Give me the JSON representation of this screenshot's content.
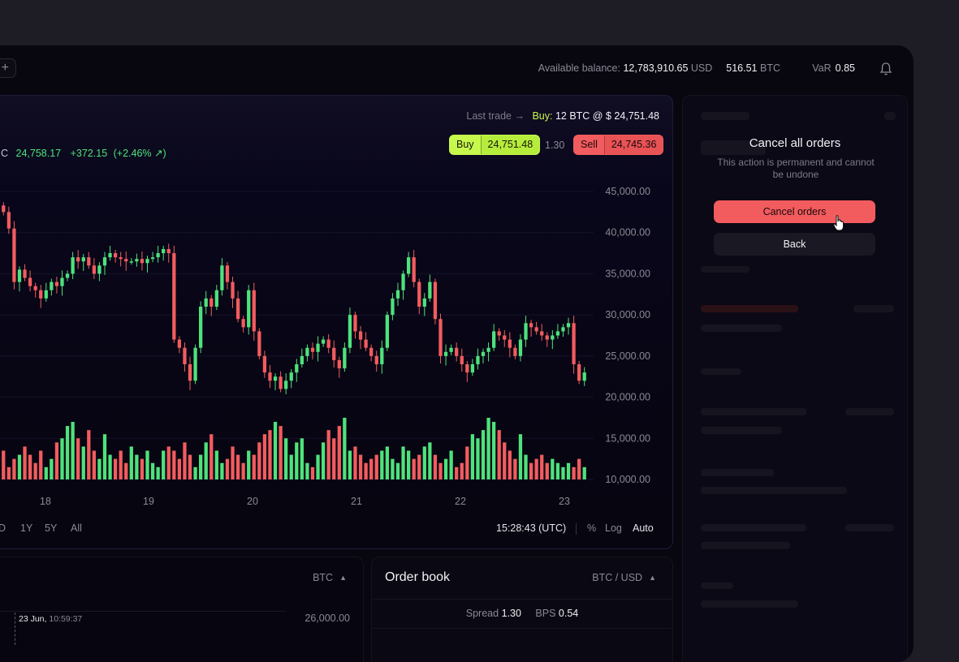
{
  "topbar": {
    "add_label": "+",
    "balance_label": "Available balance:",
    "balance_usd": "12,783,910.65",
    "usd": "USD",
    "balance_btc": "516.51",
    "btc": "BTC",
    "var_label": "VaR",
    "var_value": "0.85"
  },
  "chart_header": {
    "last_trade_label": "Last trade →",
    "last_trade_side": "Buy:",
    "last_trade_value": "12 BTC @ $ 24,751.48",
    "ticker_prefix": "C",
    "price": "24,758.17",
    "change": "+372.15",
    "change_pct": "(+2.46% ↗)",
    "buy_label": "Buy",
    "buy_price": "24,751.48",
    "spread": "1.30",
    "sell_label": "Sell",
    "sell_price": "24,745.36"
  },
  "chart_data": {
    "type": "candlestick",
    "x_ticks": [
      "18",
      "19",
      "20",
      "21",
      "22",
      "23"
    ],
    "y_ticks": [
      "45,000.00",
      "40,000.00",
      "35,000.00",
      "30,000.00",
      "25,000.00",
      "20,000.00",
      "15,000.00",
      "10,000.00"
    ],
    "ylim": [
      10000,
      45000
    ],
    "close_prices": [
      42500,
      40500,
      34000,
      35500,
      34500,
      33500,
      33000,
      32000,
      33000,
      34000,
      33500,
      34500,
      35000,
      37000,
      36500,
      37000,
      36000,
      35000,
      36000,
      37000,
      37500,
      37000,
      36800,
      36500,
      36500,
      36800,
      36300,
      36800,
      37000,
      37500,
      38000,
      37500,
      27000,
      26000,
      24000,
      22000,
      26000,
      31000,
      32000,
      31000,
      33000,
      36000,
      34000,
      32000,
      29500,
      28500,
      33000,
      28000,
      25000,
      23000,
      22000,
      22500,
      21000,
      22000,
      23000,
      24000,
      25000,
      26000,
      25500,
      26500,
      27000,
      26000,
      24500,
      23500,
      26000,
      30000,
      28000,
      27000,
      26000,
      25000,
      24000,
      26000,
      30000,
      32000,
      33000,
      35000,
      37000,
      34000,
      31000,
      32000,
      34000,
      29500,
      25000,
      25500,
      26000,
      25000,
      24000,
      23000,
      24000,
      25000,
      25500,
      26000,
      28000,
      27500,
      27000,
      26000,
      25000,
      27000,
      29000,
      28500,
      28000,
      27500,
      27000,
      27500,
      28000,
      28500,
      29000,
      24000,
      22000,
      23000
    ],
    "volumes": [
      13500,
      11500,
      12500,
      13000,
      14000,
      13000,
      12000,
      13500,
      11500,
      12500,
      14500,
      15000,
      16500,
      17000,
      15000,
      14000,
      16000,
      13500,
      12500,
      15500,
      13000,
      12500,
      13500,
      12000,
      14000,
      13000,
      12500,
      13500,
      12000,
      11500,
      13500,
      14000,
      13500,
      12500,
      14500,
      13000,
      11500,
      13000,
      14500,
      15500,
      13500,
      12000,
      12500,
      14000,
      13000,
      12000,
      13500,
      13000,
      14500,
      15500,
      16000,
      17000,
      16500,
      15000,
      13000,
      14500,
      15000,
      12000,
      11500,
      13000,
      14500,
      16000,
      15000,
      16500,
      17500,
      13500,
      14000,
      13000,
      12000,
      12500,
      13000,
      13500,
      14000,
      12500,
      12000,
      14000,
      13500,
      12500,
      13000,
      14000,
      14500,
      13000,
      12000,
      12500,
      13500,
      11500,
      12000,
      14000,
      15500,
      15000,
      16000,
      17500,
      17000,
      16000,
      14500,
      13500,
      12500,
      15500,
      13000,
      12000,
      12500,
      13000,
      12000,
      12500,
      12000,
      11500,
      12000,
      11500,
      12500,
      11500
    ],
    "volume_axis_max": 45000
  },
  "chart_footer": {
    "ranges": [
      "D",
      "1Y",
      "5Y",
      "All"
    ],
    "time": "15:28:43 (UTC)",
    "options": [
      "%",
      "Log",
      "Auto"
    ]
  },
  "modal": {
    "title": "Cancel all orders",
    "text": "This action is permanent and cannot be undone",
    "confirm": "Cancel orders",
    "back": "Back"
  },
  "depth": {
    "selector": "BTC",
    "date": "23 Jun,",
    "time": "10:59:37",
    "price": "26,000.00"
  },
  "orderbook": {
    "title": "Order book",
    "pair": "BTC / USD",
    "spread_label": "Spread",
    "spread": "1.30",
    "bps_label": "BPS",
    "bps": "0.54"
  },
  "colors": {
    "green": "#4ee27c",
    "red": "#f25c5f",
    "accent": "#c7f94d"
  }
}
